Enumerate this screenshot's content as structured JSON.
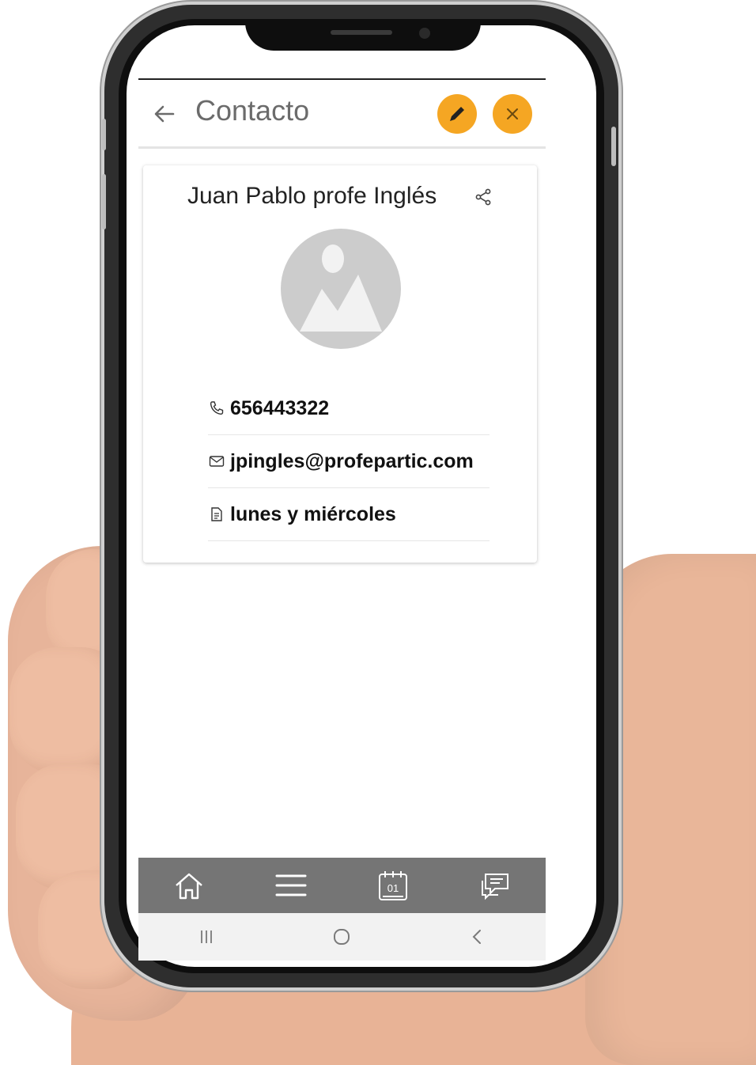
{
  "header": {
    "title": "Contacto",
    "back_icon": "arrow-left-icon",
    "edit_icon": "pencil-icon",
    "close_icon": "close-icon",
    "accent_color": "#f5a623"
  },
  "contact": {
    "name": "Juan Pablo profe Inglés",
    "share_icon": "share-icon",
    "avatar_icon": "image-placeholder-icon",
    "phone": "656443322",
    "email": "jpingles@profepartic.com",
    "note": "lunes y miércoles"
  },
  "tabbar": {
    "background": "#757575",
    "items": [
      "home-icon",
      "menu-icon",
      "calendar-icon",
      "chat-icon"
    ],
    "calendar_day": "01"
  },
  "system_nav": {
    "items": [
      "recent-apps-icon",
      "home-circle-icon",
      "back-chevron-icon"
    ]
  }
}
